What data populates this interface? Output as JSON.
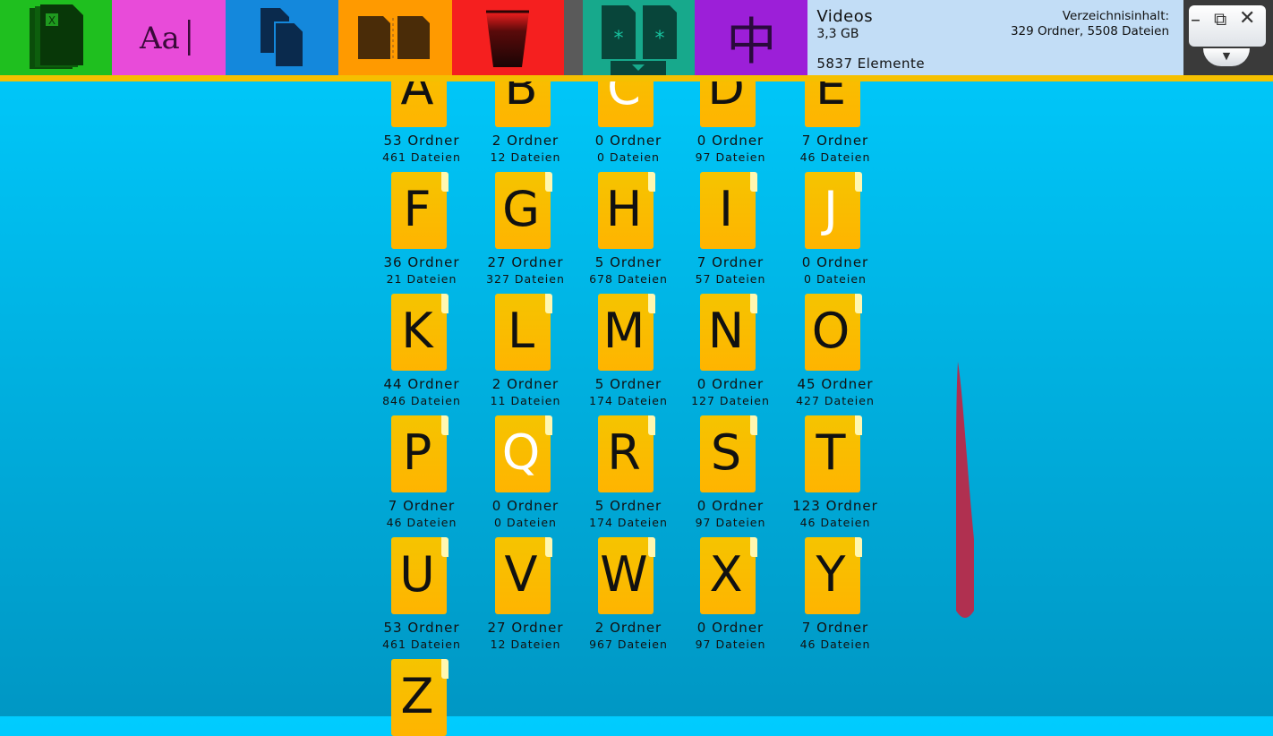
{
  "toolbar": {
    "tiles": [
      {
        "name": "excel-document-tile",
        "color": "#1fbf1f",
        "icon": "excel-icon"
      },
      {
        "name": "font-tile",
        "color": "#e84bd9",
        "icon": "font-icon",
        "label": "Aa"
      },
      {
        "name": "copy-tile",
        "color": "#1488dc",
        "icon": "copy-icon"
      },
      {
        "name": "compare-tile",
        "color": "#ff9a00",
        "icon": "compare-icon"
      },
      {
        "name": "recycle-tile",
        "color": "#f51f1f",
        "icon": "trash-cup-icon"
      },
      {
        "name": "settings-tile",
        "color": "#17a98c",
        "icon": "asterisk-documents-icon"
      },
      {
        "name": "language-tile",
        "color": "#9c1fd8",
        "icon": "chinese-character-icon",
        "label": "中"
      }
    ]
  },
  "info": {
    "name": "Videos",
    "size": "3,3 GB",
    "element_count": "5837 Elemente",
    "dir_label": "Verzeichnisinhalt:",
    "dir_value": "329 Ordner, 5508 Dateien"
  },
  "window_controls": {
    "minimize": "–",
    "maximize": "⧉",
    "close": "✕",
    "dropdown": "▼"
  },
  "folders": [
    {
      "letter": "A",
      "folders": "53 Ordner",
      "files": "461 Dateien"
    },
    {
      "letter": "B",
      "folders": "2 Ordner",
      "files": "12 Dateien"
    },
    {
      "letter": "C",
      "folders": "0 Ordner",
      "files": "0 Dateien",
      "empty": true
    },
    {
      "letter": "D",
      "folders": "0 Ordner",
      "files": "97 Dateien"
    },
    {
      "letter": "E",
      "folders": "7 Ordner",
      "files": "46 Dateien"
    },
    {
      "letter": "F",
      "folders": "36 Ordner",
      "files": "21 Dateien"
    },
    {
      "letter": "G",
      "folders": "27 Ordner",
      "files": "327 Dateien"
    },
    {
      "letter": "H",
      "folders": "5 Ordner",
      "files": "678 Dateien"
    },
    {
      "letter": "I",
      "folders": "7 Ordner",
      "files": "57 Dateien"
    },
    {
      "letter": "J",
      "folders": "0 Ordner",
      "files": "0 Dateien",
      "empty": true
    },
    {
      "letter": "K",
      "folders": "44 Ordner",
      "files": "846 Dateien"
    },
    {
      "letter": "L",
      "folders": "2 Ordner",
      "files": "11 Dateien"
    },
    {
      "letter": "M",
      "folders": "5 Ordner",
      "files": "174 Dateien"
    },
    {
      "letter": "N",
      "folders": "0 Ordner",
      "files": "127 Dateien"
    },
    {
      "letter": "O",
      "folders": "45 Ordner",
      "files": "427 Dateien"
    },
    {
      "letter": "P",
      "folders": "7 Ordner",
      "files": "46 Dateien"
    },
    {
      "letter": "Q",
      "folders": "0 Ordner",
      "files": "0 Dateien",
      "empty": true
    },
    {
      "letter": "R",
      "folders": "5 Ordner",
      "files": "174 Dateien"
    },
    {
      "letter": "S",
      "folders": "0 Ordner",
      "files": "97 Dateien"
    },
    {
      "letter": "T",
      "folders": "123 Ordner",
      "files": "46 Dateien"
    },
    {
      "letter": "U",
      "folders": "53 Ordner",
      "files": "461 Dateien"
    },
    {
      "letter": "V",
      "folders": "27 Ordner",
      "files": "12 Dateien"
    },
    {
      "letter": "W",
      "folders": "2 Ordner",
      "files": "967 Dateien"
    },
    {
      "letter": "X",
      "folders": "0 Ordner",
      "files": "97 Dateien"
    },
    {
      "letter": "Y",
      "folders": "7 Ordner",
      "files": "46 Dateien"
    },
    {
      "letter": "Z",
      "folders": "",
      "files": ""
    }
  ],
  "colors": {
    "accent": "#f5c000",
    "folder": "#ffb400",
    "scroll_indicator": "#b03050"
  }
}
